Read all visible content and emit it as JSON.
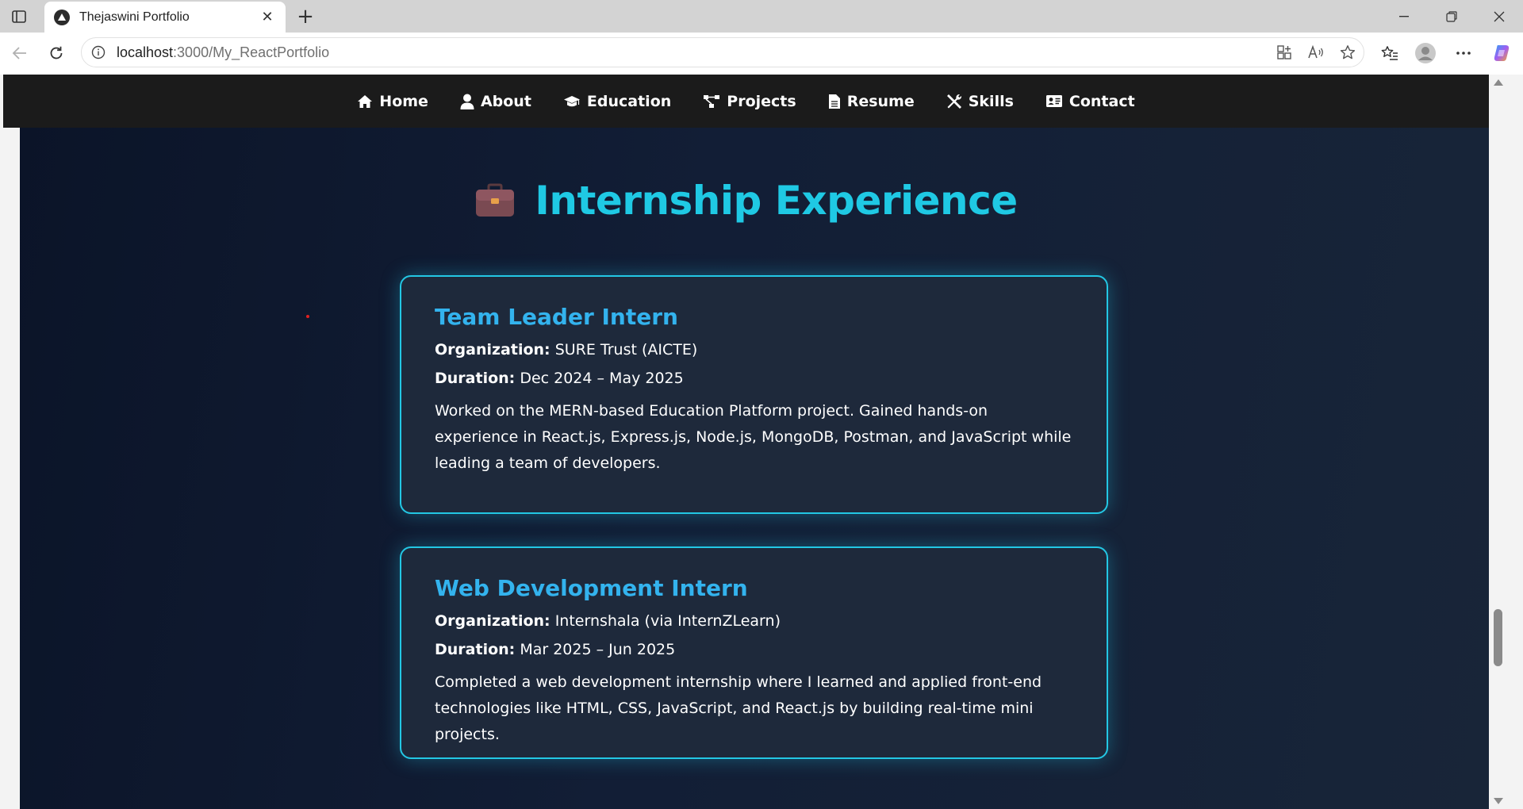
{
  "browser": {
    "tab_title": "Thejaswini Portfolio",
    "address_host": "localhost",
    "address_path": ":3000/My_ReactPortfolio"
  },
  "nav": {
    "items": [
      {
        "label": "Home",
        "icon": "home-icon"
      },
      {
        "label": "About",
        "icon": "user-icon"
      },
      {
        "label": "Education",
        "icon": "graduation-cap-icon"
      },
      {
        "label": "Projects",
        "icon": "project-diagram-icon"
      },
      {
        "label": "Resume",
        "icon": "file-icon"
      },
      {
        "label": "Skills",
        "icon": "tools-icon"
      },
      {
        "label": "Contact",
        "icon": "address-card-icon"
      }
    ]
  },
  "section": {
    "title": "Internship Experience",
    "icon": "briefcase-icon",
    "accent": "#1fc9e4"
  },
  "internships": [
    {
      "title": "Team Leader Intern",
      "org_label": "Organization:",
      "org_value": "SURE Trust (AICTE)",
      "duration_label": "Duration:",
      "duration_value": "Dec 2024 – May 2025",
      "description": "Worked on the MERN-based Education Platform project. Gained hands-on experience in React.js, Express.js, Node.js, MongoDB, Postman, and JavaScript while leading a team of developers."
    },
    {
      "title": "Web Development Intern",
      "org_label": "Organization:",
      "org_value": "Internshala (via InternZLearn)",
      "duration_label": "Duration:",
      "duration_value": "Mar 2025 – Jun 2025",
      "description": "Completed a web development internship where I learned and applied front-end technologies like HTML, CSS, JavaScript, and React.js by building real-time mini projects."
    }
  ],
  "colors": {
    "card_border": "#23c7e4",
    "card_title": "#33b3ee",
    "card_bg": "#1e293b",
    "navbar_bg": "#1b1b1b"
  }
}
